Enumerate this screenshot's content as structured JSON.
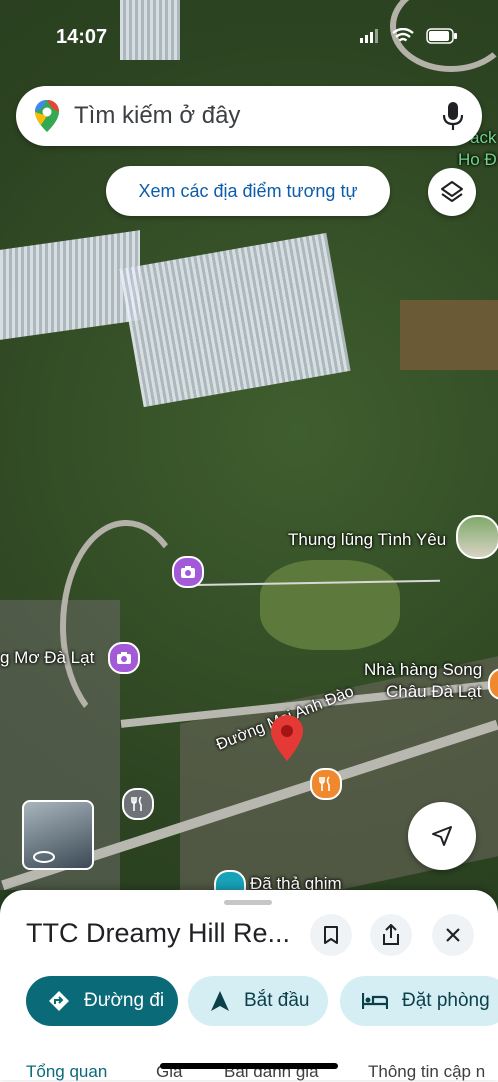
{
  "status": {
    "time": "14:07"
  },
  "search": {
    "placeholder": "Tìm kiếm ở đây"
  },
  "similar_button": "Xem các địa điểm tương tự",
  "map_labels": {
    "valley": "Thung lũng Tình Yêu",
    "mo_dalat": "g Mơ Đà Lạt",
    "restaurant_line1": "Nhà hàng Song",
    "restaurant_line2": "Châu Đà Lạt",
    "street": "Đường Mai Anh Đào",
    "dropped_pin": "Đã thả ghim",
    "corner_line1": "ack",
    "corner_line2": "Ho Đ"
  },
  "place": {
    "title": "TTC Dreamy Hill Re..."
  },
  "actions": {
    "directions": "Đường đi",
    "start": "Bắt đầu",
    "book": "Đặt phòng"
  },
  "tabs": [
    "Tổng quan",
    "Giá",
    "Bài đánh giá",
    "Thông tin cập n"
  ],
  "colors": {
    "accent": "#0b6a78",
    "action_bg": "#d4eef4",
    "pin_red": "#e53935",
    "link_blue": "#0b5cad"
  }
}
